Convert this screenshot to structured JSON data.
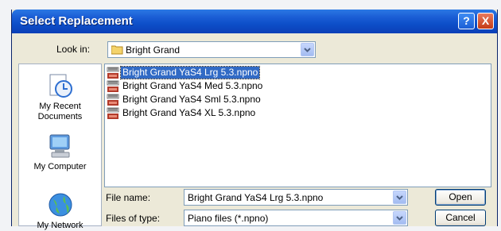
{
  "window": {
    "title": "Select Replacement"
  },
  "titlebar": {
    "help_label": "?",
    "close_label": "X"
  },
  "look_in": {
    "label": "Look in:",
    "value": "Bright Grand"
  },
  "places": [
    {
      "label": "My Recent\nDocuments"
    },
    {
      "label": "My Computer"
    },
    {
      "label": "My Network"
    }
  ],
  "files": [
    {
      "name": "Bright Grand YaS4  Lrg 5.3.npno",
      "selected": true
    },
    {
      "name": "Bright Grand YaS4  Med 5.3.npno",
      "selected": false
    },
    {
      "name": "Bright Grand YaS4  Sml 5.3.npno",
      "selected": false
    },
    {
      "name": "Bright Grand YaS4  XL 5.3.npno",
      "selected": false
    }
  ],
  "file_name": {
    "label": "File name:",
    "value": "Bright Grand YaS4  Lrg 5.3.npno"
  },
  "file_type": {
    "label": "Files of type:",
    "value": "Piano files (*.npno)"
  },
  "buttons": {
    "open": "Open",
    "cancel": "Cancel"
  },
  "icons": {
    "back": "back-icon",
    "up": "up-folder-icon",
    "new_folder": "new-folder-icon",
    "views": "views-menu-icon",
    "file": "npno-file-icon"
  },
  "colors": {
    "title_bar": "#0d4fc9",
    "selection": "#316ac5",
    "dialog_bg": "#ece9d8"
  }
}
